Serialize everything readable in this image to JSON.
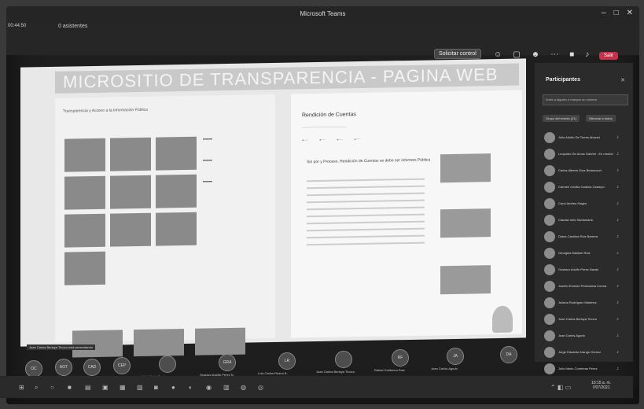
{
  "window": {
    "title": "Microsoft Teams",
    "controls": [
      "–",
      "□",
      "✕"
    ]
  },
  "meeting": {
    "time": "00:44:50",
    "status": "0 asistentes",
    "request_control": "Solicitar control",
    "leave": "Salir",
    "toolbar_icons": [
      "people-icon",
      "chat-icon",
      "reactions-icon",
      "more-icon",
      "camera-icon",
      "mic-icon",
      "share-icon"
    ]
  },
  "shared_page": {
    "banner": "MICROSITIO DE TRANSPARENCIA - PAGINA WEB",
    "left_heading": "Transparencia y Acceso a la Información Pública",
    "tiles": [
      "",
      "",
      "",
      "",
      "",
      "",
      "",
      "",
      "",
      "",
      "",
      "",
      ""
    ],
    "right_title": "Rendición de Cuentas",
    "right_lead": "Sin por y Proceso, Rendición de Cuentas se debe ser informes Pública"
  },
  "participants_panel": {
    "title": "Participantes",
    "invite_placeholder": "Invite a alguien o marque un número",
    "tab_1": "Grupo del evento (21)",
    "tab_2": "Silenciar a todos",
    "people": [
      "Julio Adolfo De Torres Alvarez",
      "Leopoldo De Arcos Gabriel - En reunión",
      "Carlos Alberto Díaz Betancourt",
      "Carmen Cecilia Cadena Ocampo",
      "Carol Andrea Hagen",
      "Claudia Inés Santamaria",
      "Diana Carolina Ruiz Barrera",
      "Georgina Naidum Ruiz",
      "Gustavo Adolfo Perez Navas",
      "Joselín Ernesto Pedrosana Correa",
      "Juliana Rodríguez Martinez",
      "Juan Carlos Bedoya Tinoco",
      "Juan Carlos Agudo",
      "Jorge Eduardo Arango Gómez",
      "Julio Mario Contreras Perez"
    ]
  },
  "bottom_strip": {
    "caption": "Juan Carlos Bedoya Tinoco está presentando",
    "avatars": [
      {
        "initials": "OC",
        "label": ""
      },
      {
        "initials": "AOT",
        "label": ""
      },
      {
        "initials": "CAD",
        "label": ""
      },
      {
        "initials": "CEP",
        "label": ""
      },
      {
        "initials": "",
        "label": "Julio Mario Contreras"
      },
      {
        "initials": "GRA",
        "label": "Gustavo Adolfo Perez N."
      },
      {
        "initials": "LR",
        "label": "Luis Carlos Rivera B."
      },
      {
        "initials": "",
        "label": "Juan Carlos Bedoya Tinoco"
      },
      {
        "initials": "RF",
        "label": "Rafael Guillermo Ruiz"
      },
      {
        "initials": "JA",
        "label": "Juan Carlos Agudo"
      },
      {
        "initials": "DA",
        "label": ""
      }
    ]
  },
  "taskbar": {
    "clock_time": "10:15 a. m.",
    "clock_date": "7/07/2021"
  }
}
